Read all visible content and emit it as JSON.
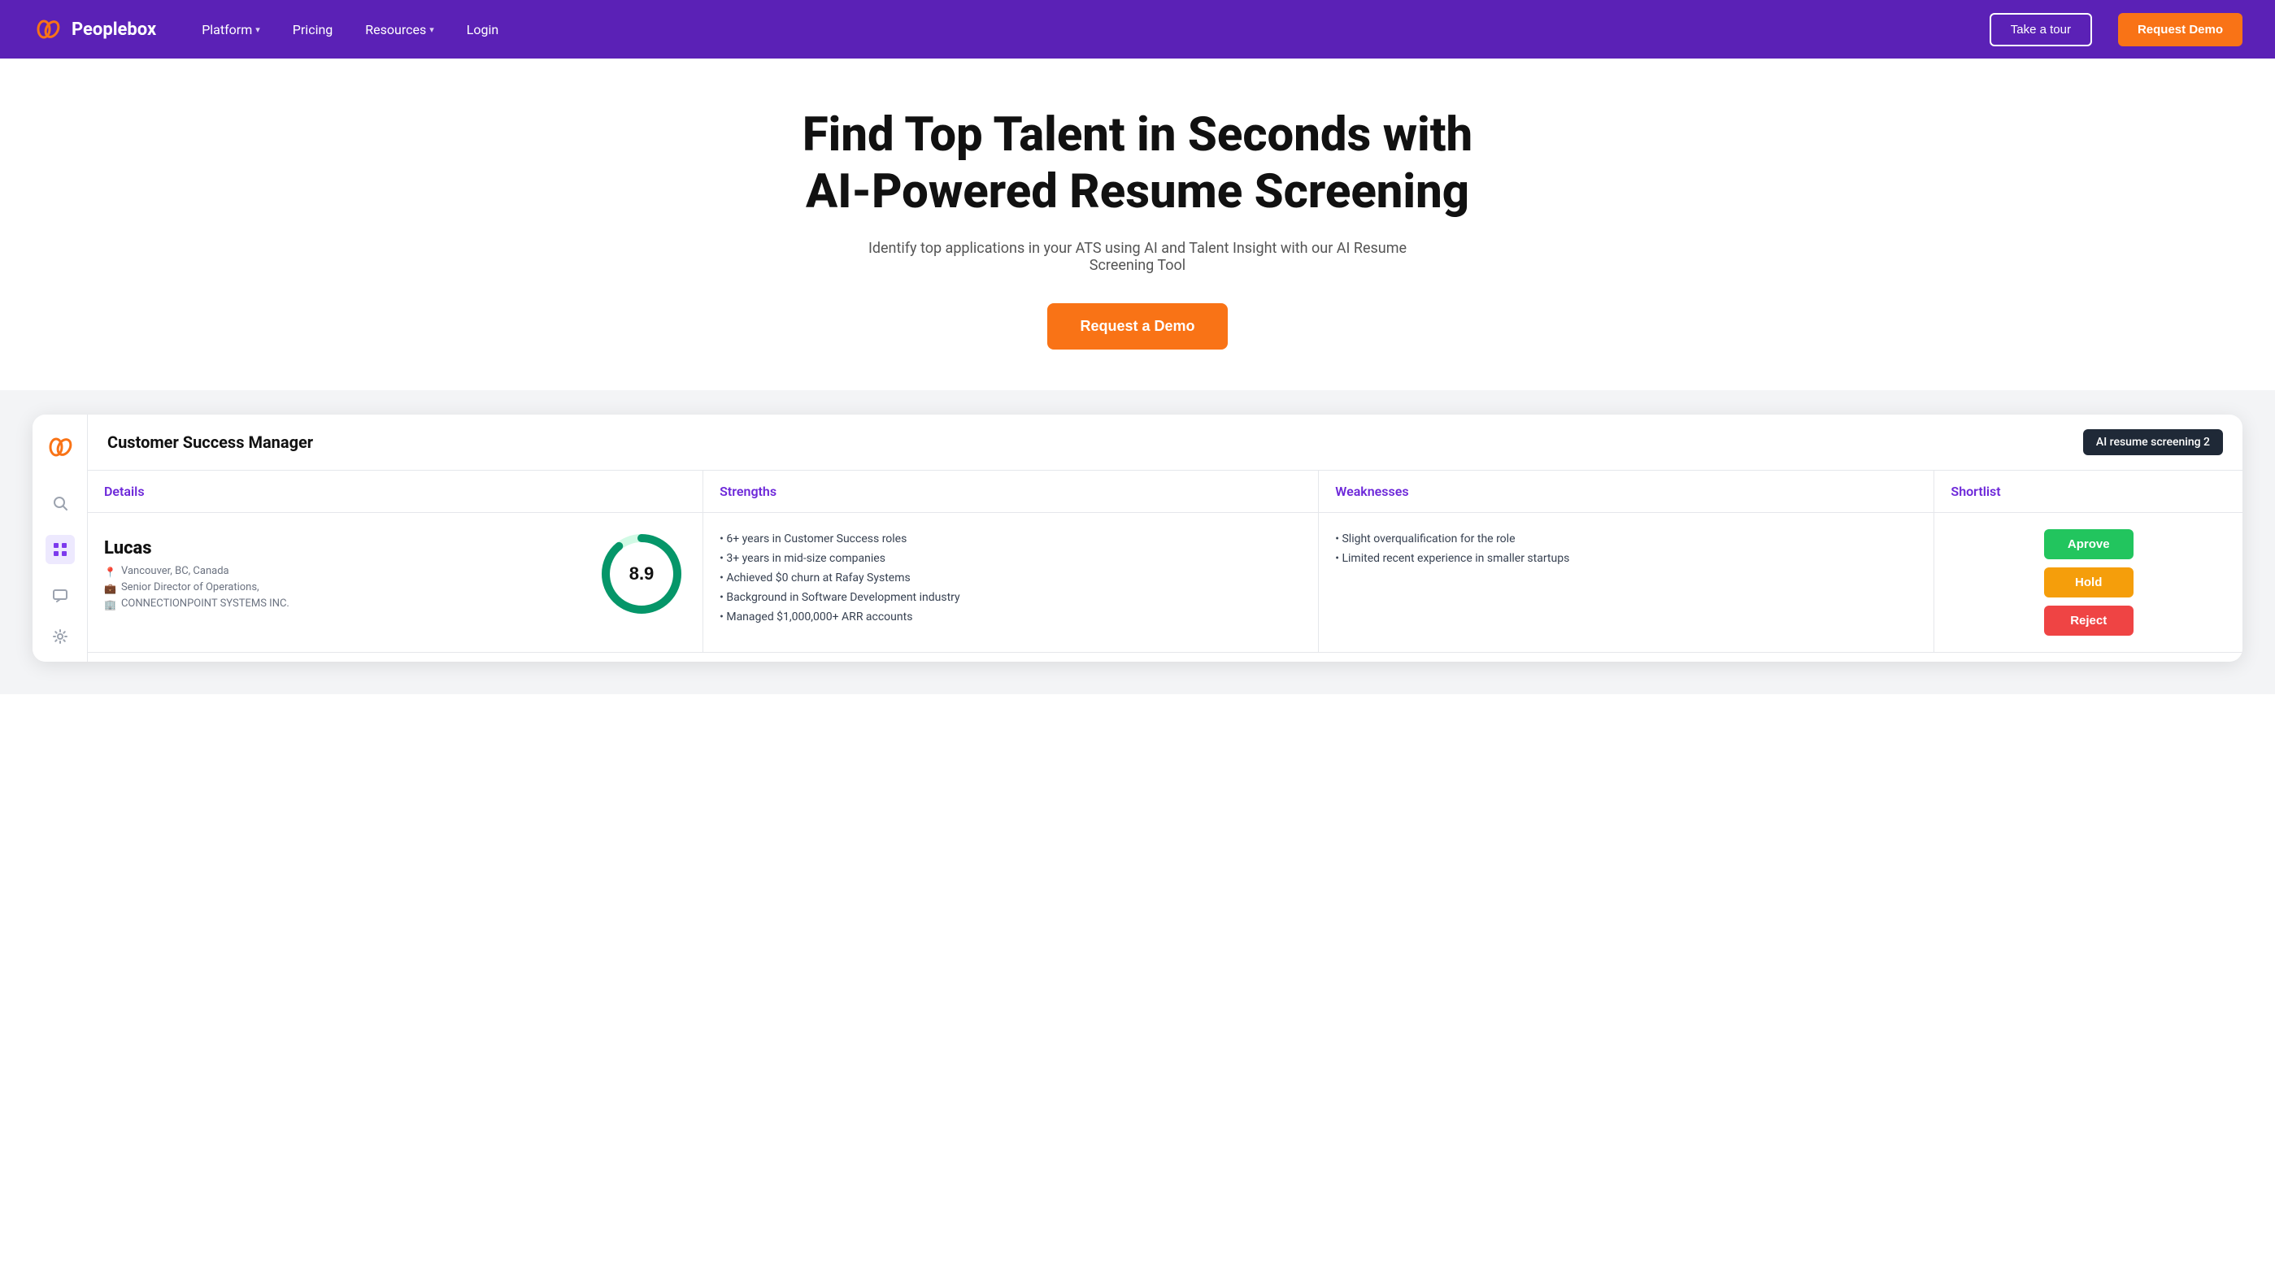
{
  "nav": {
    "logo_text": "Peoplebox",
    "items": [
      {
        "label": "Platform",
        "has_dropdown": true
      },
      {
        "label": "Pricing",
        "has_dropdown": false
      },
      {
        "label": "Resources",
        "has_dropdown": true
      },
      {
        "label": "Login",
        "has_dropdown": false
      }
    ],
    "btn_tour": "Take a tour",
    "btn_demo": "Request Demo"
  },
  "hero": {
    "heading_line1": "Find Top Talent in Seconds with",
    "heading_line2": "AI-Powered Resume Screening",
    "subtext": "Identify top applications in your ATS using AI and Talent Insight with our AI Resume Screening Tool",
    "cta_label": "Request a Demo"
  },
  "app": {
    "job_title": "Customer Success Manager",
    "ai_badge": "AI resume screening 2",
    "table": {
      "headers": [
        "Details",
        "Strengths",
        "Weaknesses",
        "Shortlist"
      ],
      "candidate": {
        "name": "Lucas",
        "location": "Vancouver, BC, Canada",
        "current_role": "Senior Director of Operations,",
        "company": "CONNECTIONPOINT SYSTEMS INC.",
        "score": "8.9",
        "score_value": 89,
        "strengths": [
          "6+ years in Customer Success roles",
          "3+ years in mid-size companies",
          "Achieved $0 churn at Rafay Systems",
          "Background in Software Development industry",
          "Managed $1,000,000+ ARR accounts"
        ],
        "weaknesses": [
          "Slight overqualification for the role",
          "Limited recent experience in smaller startups"
        ],
        "shortlist_buttons": {
          "approve": "Aprove",
          "hold": "Hold",
          "reject": "Reject"
        }
      }
    }
  },
  "sidebar_icons": {
    "search": "🔍",
    "dashboard": "▦",
    "chat": "💬",
    "settings": "⚙"
  },
  "colors": {
    "nav_bg": "#5b21b6",
    "accent_orange": "#f97316",
    "accent_purple": "#6d28d9",
    "approve_green": "#22c55e",
    "hold_amber": "#f59e0b",
    "reject_red": "#ef4444",
    "score_green": "#059669",
    "score_track": "#d1fae5"
  }
}
